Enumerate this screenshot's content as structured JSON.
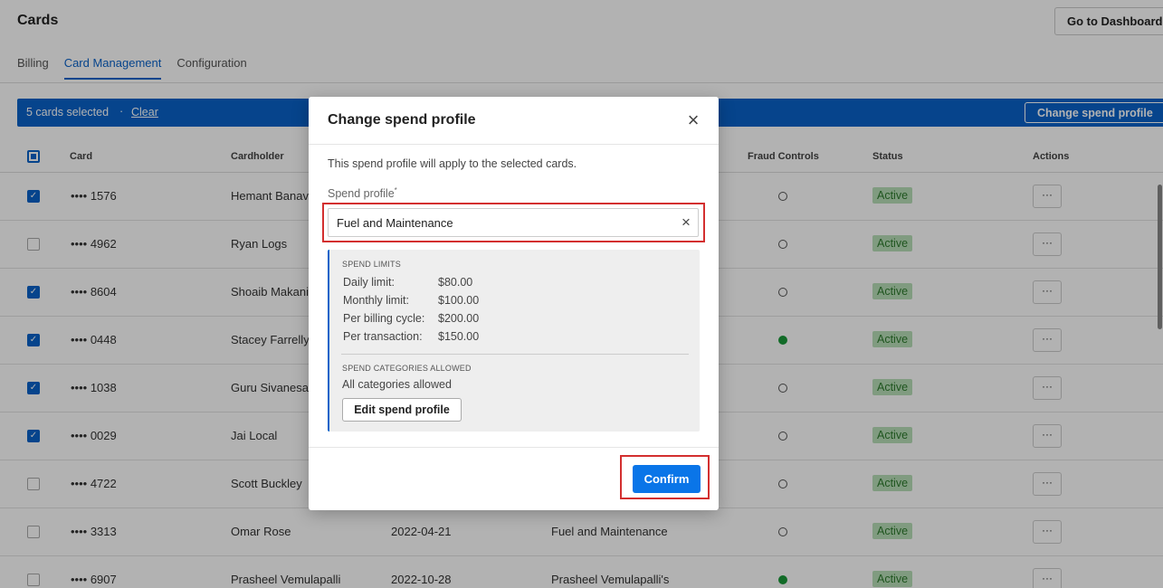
{
  "header": {
    "title": "Cards",
    "dashboard_button": "Go to Dashboard"
  },
  "tabs": [
    {
      "label": "Billing"
    },
    {
      "label": "Card Management"
    },
    {
      "label": "Configuration"
    }
  ],
  "selection_bar": {
    "count_text": "5 cards selected",
    "separator": "·",
    "clear_label": "Clear",
    "change_label": "Change spend profile"
  },
  "table": {
    "headers": {
      "card": "Card",
      "cardholder": "Cardholder",
      "fraud": "Fraud Controls",
      "status": "Status",
      "actions": "Actions"
    },
    "action_label": "···",
    "rows": [
      {
        "checked": true,
        "card": "•••• 1576",
        "cardholder": "Hemant Banava",
        "date": "",
        "profile": "",
        "fraud_on": false,
        "status": "Active"
      },
      {
        "checked": false,
        "card": "•••• 4962",
        "cardholder": "Ryan Logs",
        "date": "",
        "profile": "",
        "fraud_on": false,
        "status": "Active"
      },
      {
        "checked": true,
        "card": "•••• 8604",
        "cardholder": "Shoaib Makani",
        "date": "",
        "profile": "",
        "fraud_on": false,
        "status": "Active"
      },
      {
        "checked": true,
        "card": "•••• 0448",
        "cardholder": "Stacey Farrelly",
        "date": "",
        "profile": "",
        "fraud_on": true,
        "status": "Active"
      },
      {
        "checked": true,
        "card": "•••• 1038",
        "cardholder": "Guru Sivanesar",
        "date": "",
        "profile": "",
        "fraud_on": false,
        "status": "Active"
      },
      {
        "checked": true,
        "card": "•••• 0029",
        "cardholder": "Jai Local",
        "date": "",
        "profile": "",
        "fraud_on": false,
        "status": "Active"
      },
      {
        "checked": false,
        "card": "•••• 4722",
        "cardholder": "Scott Buckley",
        "date": "",
        "profile": "",
        "fraud_on": false,
        "status": "Active"
      },
      {
        "checked": false,
        "card": "•••• 3313",
        "cardholder": "Omar Rose",
        "date": "2022-04-21",
        "profile": "Fuel and Maintenance",
        "fraud_on": false,
        "status": "Active"
      },
      {
        "checked": false,
        "card": "•••• 6907",
        "cardholder": "Prasheel Vemulapalli",
        "date": "2022-10-28",
        "profile": "Prasheel Vemulapalli's",
        "fraud_on": true,
        "status": "Active"
      }
    ]
  },
  "modal": {
    "title": "Change spend profile",
    "close_icon": "close-icon",
    "description": "This spend profile will apply to the selected cards.",
    "field_label": "Spend profile",
    "required_mark": "*",
    "field_value": "Fuel and Maintenance",
    "limits_heading": "SPEND LIMITS",
    "limits": [
      {
        "label": "Daily limit:",
        "value": "$80.00"
      },
      {
        "label": "Monthly limit:",
        "value": "$100.00"
      },
      {
        "label": "Per billing cycle:",
        "value": "$200.00"
      },
      {
        "label": "Per transaction:",
        "value": "$150.00"
      }
    ],
    "categories_heading": "SPEND CATEGORIES ALLOWED",
    "categories_value": "All categories allowed",
    "edit_button": "Edit spend profile",
    "confirm_button": "Confirm"
  },
  "colors": {
    "primary": "#0a62c9",
    "confirm": "#0a75e8",
    "highlight": "#d32f2f",
    "active_badge_bg": "#b8dfb8",
    "fraud_on": "#1a9a3a"
  }
}
